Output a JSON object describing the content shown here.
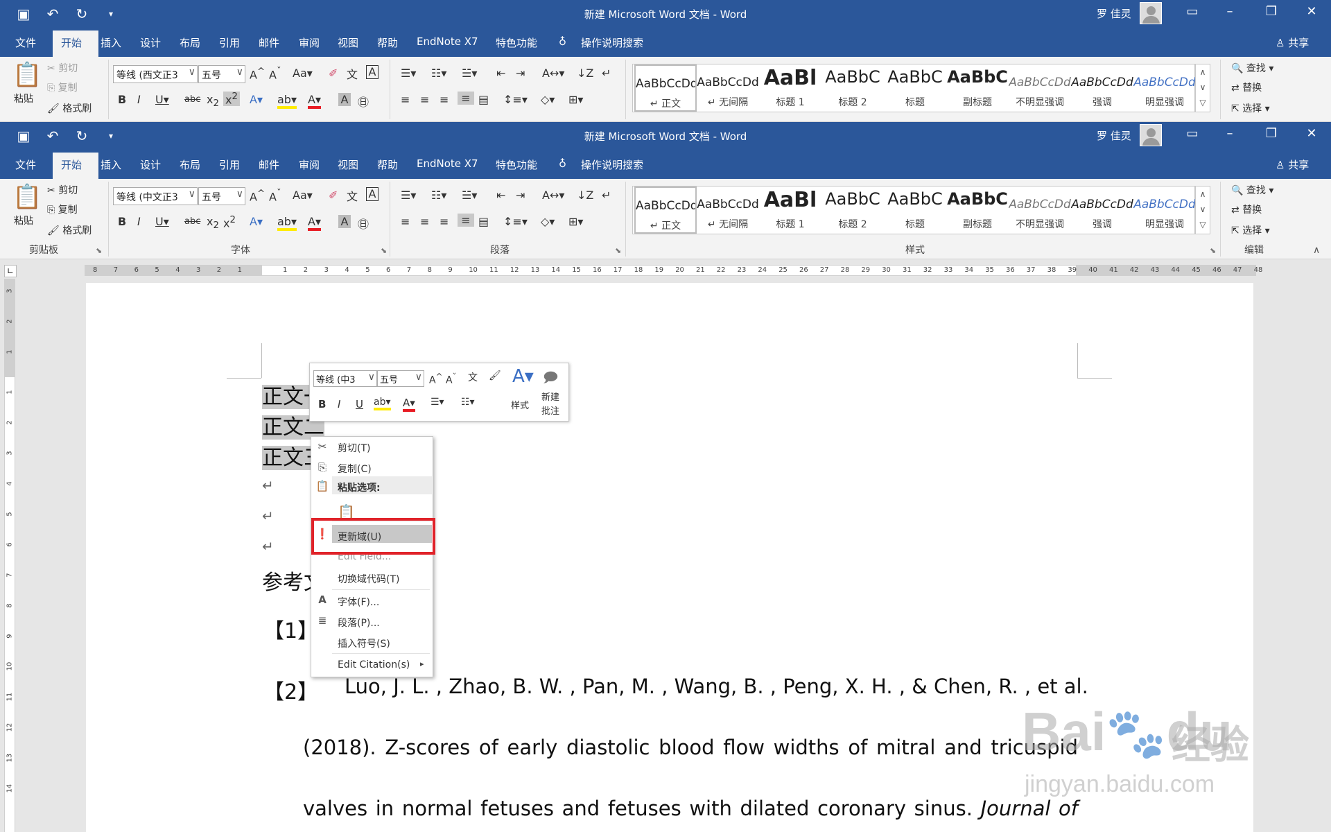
{
  "app": {
    "title": "新建 Microsoft Word 文档  -  Word",
    "user": "罗 佳灵",
    "share": "共享"
  },
  "qat": {
    "save_icon": "save-icon",
    "undo_icon": "undo-icon",
    "redo_icon": "redo-icon",
    "more_icon": "chevron-down-icon"
  },
  "tabs": [
    "文件",
    "开始",
    "插入",
    "设计",
    "布局",
    "引用",
    "邮件",
    "审阅",
    "视图",
    "帮助",
    "EndNote X7",
    "特色功能"
  ],
  "tell_me": "操作说明搜索",
  "clipboard": {
    "paste": "粘贴",
    "cut": "剪切",
    "copy": "复制",
    "format_painter": "格式刷",
    "group": "剪贴板"
  },
  "font": {
    "font_name_top": "等线 (西文正3",
    "font_name_bottom": "等线 (中文正3",
    "font_size": "五号",
    "group": "字体"
  },
  "paragraph": {
    "group": "段落"
  },
  "styles": {
    "group": "样式",
    "items": [
      {
        "preview": "AaBbCcDd",
        "name": "↵ 正文"
      },
      {
        "preview": "AaBbCcDd",
        "name": "↵ 无间隔"
      },
      {
        "preview": "AaBl",
        "name": "标题 1"
      },
      {
        "preview": "AaBbC",
        "name": "标题 2"
      },
      {
        "preview": "AaBbC",
        "name": "标题"
      },
      {
        "preview": "AaBbC",
        "name": "副标题"
      },
      {
        "preview": "AaBbCcDd",
        "name": "不明显强调"
      },
      {
        "preview": "AaBbCcDd",
        "name": "强调"
      },
      {
        "preview": "AaBbCcDd",
        "name": "明显强调"
      }
    ]
  },
  "editing": {
    "find": "查找",
    "replace": "替换",
    "select": "选择",
    "group": "编辑"
  },
  "ruler": {
    "h_left": [
      "8",
      "7",
      "6",
      "5",
      "4",
      "3",
      "2",
      "1"
    ],
    "h_right": [
      "1",
      "2",
      "3",
      "4",
      "5",
      "6",
      "7",
      "8",
      "9",
      "10",
      "11",
      "12",
      "13",
      "14",
      "15",
      "16",
      "17",
      "18",
      "19",
      "20",
      "21",
      "22",
      "23",
      "24",
      "25",
      "26",
      "27",
      "28",
      "29",
      "30",
      "31",
      "32",
      "33",
      "34",
      "35",
      "36",
      "37",
      "38",
      "39",
      "40",
      "41",
      "42",
      "43",
      "44",
      "45",
      "46",
      "47",
      "48"
    ],
    "v_top": [
      "3",
      "2",
      "1"
    ],
    "v_bottom": [
      "1",
      "2",
      "3",
      "4",
      "5",
      "6",
      "7",
      "8",
      "9",
      "10",
      "11",
      "12",
      "13",
      "14"
    ]
  },
  "document": {
    "line1": "正文一",
    "line2": "正文二",
    "line3": "正文三",
    "para_mark": "↵",
    "refs_heading": "参考文献",
    "ref1_label": "【1】",
    "ref2_label": "【2】",
    "ref2_line1": "Luo, J. L. , Zhao, B. W. , Pan, M. , Wang, B. , Peng, X. H. , & Chen, R. , et al.",
    "ref2_line2": "(2018). Z-scores of early diastolic blood flow widths of mitral and tricuspid",
    "ref2_line3_a": "valves in normal fetuses and fetuses with dilated coronary sinus. ",
    "ref2_line3_b": "Journal of"
  },
  "mini_toolbar": {
    "font_name": "等线 (中3",
    "font_size": "五号",
    "styles": "样式",
    "new_comment_1": "新建",
    "new_comment_2": "批注"
  },
  "context_menu": {
    "cut": "剪切(T)",
    "copy": "复制(C)",
    "paste_options": "粘贴选项:",
    "update_field": "更新域(U)",
    "edit_field": "Edit Field...",
    "toggle_field": "切换域代码(T)",
    "font": "字体(F)...",
    "paragraph": "段落(P)...",
    "insert_symbol": "插入符号(S)",
    "edit_citation": "Edit Citation(s)"
  },
  "watermark": {
    "brand": "Bai",
    "brand2": "du",
    "cn": "经验",
    "url": "jingyan.baidu.com"
  },
  "colors": {
    "title_blue": "#2b579a",
    "highlight_red": "#e0232a",
    "selection_gray": "#c8c8c8"
  }
}
